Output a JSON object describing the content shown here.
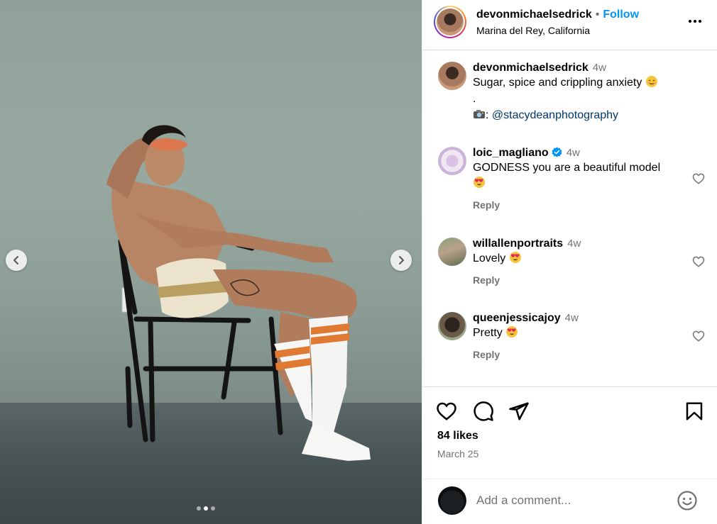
{
  "post": {
    "author": "devonmichaelsedrick",
    "follow_label": "Follow",
    "separator": "•",
    "location": "Marina del Rey, California",
    "caption_lines": [
      "Sugar, spice and crippling anxiety",
      ".",
      ": "
    ],
    "caption_mention": "@stacydeanphotography",
    "caption_time": "4w",
    "carousel": {
      "slide_count": 3,
      "active_slide": 2
    }
  },
  "comments": [
    {
      "username": "loic_magliano",
      "verified": true,
      "time": "4w",
      "text": "GODNESS you are a beautiful model",
      "reply_label": "Reply"
    },
    {
      "username": "willallenportraits",
      "verified": false,
      "time": "4w",
      "text": "Lovely",
      "reply_label": "Reply"
    },
    {
      "username": "queenjessicajoy",
      "verified": false,
      "time": "4w",
      "text": "Pretty",
      "reply_label": "Reply"
    }
  ],
  "stats": {
    "likes": "84 likes",
    "date": "March 25"
  },
  "add_comment": {
    "placeholder": "Add a comment..."
  },
  "icons": {
    "like": "heart-icon",
    "comment": "comment-icon",
    "share": "share-icon",
    "save": "bookmark-icon",
    "emoji": "smiley-icon",
    "more": "more-icon",
    "verified": "verified-badge-icon",
    "prev": "chevron-left-icon",
    "next": "chevron-right-icon"
  },
  "colors": {
    "accent": "#0095f6",
    "mention": "#00376b",
    "secondary_text": "#737373",
    "verified": "#0095f6"
  }
}
